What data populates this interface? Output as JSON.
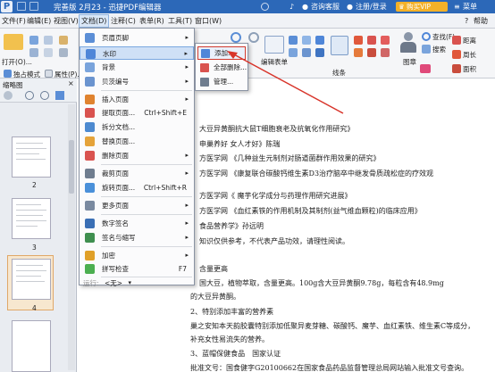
{
  "titlebar": {
    "app_letter": "P",
    "title": "完善版 2月23 - 迅捷PDF编辑器",
    "chat": "咨询客服",
    "login": "注册/登录",
    "vip": "购买VIP",
    "menu": "菜单"
  },
  "menubar": {
    "items": [
      "文件(F)",
      "编辑(E)",
      "视图(V)",
      "文档(D)",
      "注释(C)",
      "表单(R)",
      "工具(T)",
      "窗口(W)"
    ],
    "help": "帮助"
  },
  "toolbar": {
    "open": "打开(O)...",
    "unlock": "独占模式",
    "properties": "属性(P)...",
    "edit_form": "编辑表单",
    "line": "线条",
    "shape": "图章",
    "find": "查找(F)",
    "search": "搜索",
    "distance": "距离",
    "perimeter": "周长",
    "area": "面积"
  },
  "leftpanel": {
    "title": "缩略图",
    "pages": [
      "2",
      "3",
      "4"
    ]
  },
  "dropdown": {
    "items": [
      {
        "label": "页眉页脚",
        "arrow": "▸",
        "color": "#5b8ed6"
      },
      {
        "label": "水印",
        "arrow": "▸",
        "color": "#4f86d8"
      },
      {
        "label": "背景",
        "arrow": "▸",
        "color": "#7aa4dc"
      },
      {
        "label": "贝茨编号",
        "arrow": "▸",
        "color": "#6b94cf"
      },
      {
        "label": "插入页面",
        "arrow": "▸",
        "color": "#e0832f"
      },
      {
        "label": "提取页面...",
        "shortcut": "Ctrl+Shift+E",
        "color": "#d9534f"
      },
      {
        "label": "拆分文档...",
        "color": "#4d8ad0"
      },
      {
        "label": "替换页面...",
        "color": "#e5a33a"
      },
      {
        "label": "删除页面",
        "arrow": "▸",
        "color": "#d9534f"
      },
      {
        "label": "裁剪页面",
        "arrow": "▸",
        "color": "#6f7d8f"
      },
      {
        "label": "旋转页面...",
        "shortcut": "Ctrl+Shift+R",
        "color": "#4a90d9"
      },
      {
        "label": "更多页面",
        "arrow": "▸",
        "color": "#7a8aa0"
      },
      {
        "label": "数字签名",
        "arrow": "▸",
        "color": "#3a6fb5"
      },
      {
        "label": "签名与缩写",
        "arrow": "▸",
        "color": "#3f8f4f"
      },
      {
        "label": "加密",
        "arrow": "▸",
        "color": "#e0a028"
      },
      {
        "label": "拼写检查",
        "shortcut": "F7",
        "color": "#4caf50"
      },
      {
        "label": "运行:",
        "value": "<无>",
        "arrow": "▾",
        "color": "#9aa3b0"
      }
    ]
  },
  "submenu": {
    "items": [
      {
        "label": "添加...",
        "color": "#4f86d8"
      },
      {
        "label": "全部删除...",
        "color": "#d9534f"
      },
      {
        "label": "管理...",
        "color": "#6f7d8f"
      }
    ]
  },
  "document": {
    "lines": [
      "大豆异黄酮抗大鼠T细胞衰老及抗氧化作用研究》",
      "申巢养好 女人才好》陈瑞",
      "方医学网 《几种益生元制剂对肠道菌群作用效果的研究》",
      "方医学网 《康复联合碳酸钙维生素D3治疗脑卒中继发骨质疏松症的疗效观",
      "方医学网《 魔芋化学成分与药理作用研究进展》",
      "方医学网 《血红素铁的作用机制及其制剂(益气维血颗粒)的临床应用》",
      "食品营养学》孙远明",
      "知识仅供参考，不代表产品功效，请理性阅读。",
      "含量更高",
      "国大豆，植物萃取，含量更高。100g含大豆异黄酮9.78g，每粒含有48.9mg",
      "的大豆异黄酮。",
      "2、特别添加丰富的营养素",
      "巢之安知本天韵胶囊特别添加低聚异麦芽糖、碳酸钙、魔芋、血红素铁、维生素C等成分，",
      "补充女性易流失的营养。",
      "3、蓝帽保健食品　国家认证",
      "批准文号：国食健字G20100662在国家食品药品监督管理总局网站输入批准文号查询。"
    ]
  }
}
